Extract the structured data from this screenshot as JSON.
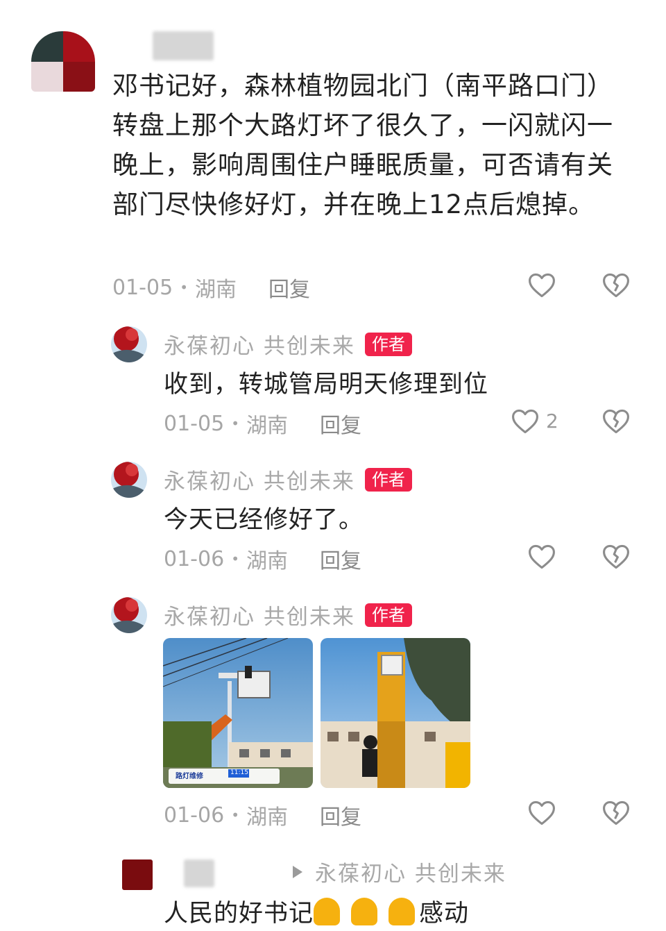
{
  "main_comment": {
    "text": "邓书记好，森林植物园北门（南平路口门）转盘上那个大路灯坏了很久了，一闪就闪一晚上，影响周围住户睡眠质量，可否请有关部门尽快修好灯，并在晚上12点后熄掉。",
    "date": "01-05",
    "location": "湖南",
    "reply_label": "回复"
  },
  "replies": [
    {
      "author": "永葆初心  共创未来",
      "badge": "作者",
      "text": "收到，转城管局明天修理到位",
      "date": "01-05",
      "location": "湖南",
      "reply_label": "回复",
      "likes": "2"
    },
    {
      "author": "永葆初心  共创未来",
      "badge": "作者",
      "text": "今天已经修好了。",
      "date": "01-06",
      "location": "湖南",
      "reply_label": "回复"
    },
    {
      "author": "永葆初心  共创未来",
      "badge": "作者",
      "photo_caption": "路灯维修",
      "photo_time": "11:15",
      "date": "01-06",
      "location": "湖南",
      "reply_label": "回复"
    }
  ],
  "sub_reply": {
    "reply_to": "永葆初心  共创未来",
    "text_before": "人民的好书记",
    "text_after": "感动"
  },
  "icons": {
    "like": "heart-outline-icon",
    "dislike": "broken-heart-icon",
    "arrow": "play-triangle-icon"
  },
  "colors": {
    "badge": "#f0234b",
    "meta": "#a6a6a6",
    "text": "#222222"
  }
}
